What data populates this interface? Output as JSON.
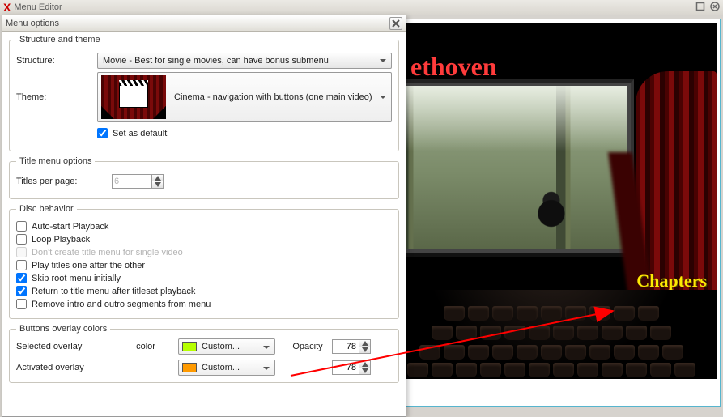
{
  "parent_window": {
    "title": "Menu Editor"
  },
  "dialog": {
    "title": "Menu options",
    "structure_theme": {
      "legend": "Structure and theme",
      "structure_label": "Structure:",
      "structure_value": "Movie - Best for single movies, can have bonus submenu",
      "theme_label": "Theme:",
      "theme_value": "Cinema - navigation with buttons (one main video)",
      "set_default_label": "Set as default",
      "set_default_checked": true
    },
    "title_menu": {
      "legend": "Title menu options",
      "titles_per_page_label": "Titles per page:",
      "titles_per_page_value": "6"
    },
    "disc": {
      "legend": "Disc behavior",
      "items": [
        {
          "label": "Auto-start Playback",
          "checked": false,
          "disabled": false
        },
        {
          "label": "Loop Playback",
          "checked": false,
          "disabled": false
        },
        {
          "label": "Don't create title menu for single video",
          "checked": false,
          "disabled": true
        },
        {
          "label": "Play titles one after the other",
          "checked": false,
          "disabled": false
        },
        {
          "label": "Skip root menu initially",
          "checked": true,
          "disabled": false
        },
        {
          "label": "Return to title menu after titleset playback",
          "checked": true,
          "disabled": false
        },
        {
          "label": "Remove intro and outro segments from menu",
          "checked": false,
          "disabled": false
        }
      ]
    },
    "buttons_overlay": {
      "legend": "Buttons overlay colors",
      "color_header": "color",
      "opacity_header": "Opacity",
      "selected_label": "Selected overlay",
      "activated_label": "Activated overlay",
      "custom_label": "Custom...",
      "selected_color": "#b6ff00",
      "activated_color": "#ff9a00",
      "selected_opacity": "78",
      "activated_opacity": "78"
    }
  },
  "preview": {
    "movie_title": "ethoven",
    "chapters_label": "Chapters"
  }
}
